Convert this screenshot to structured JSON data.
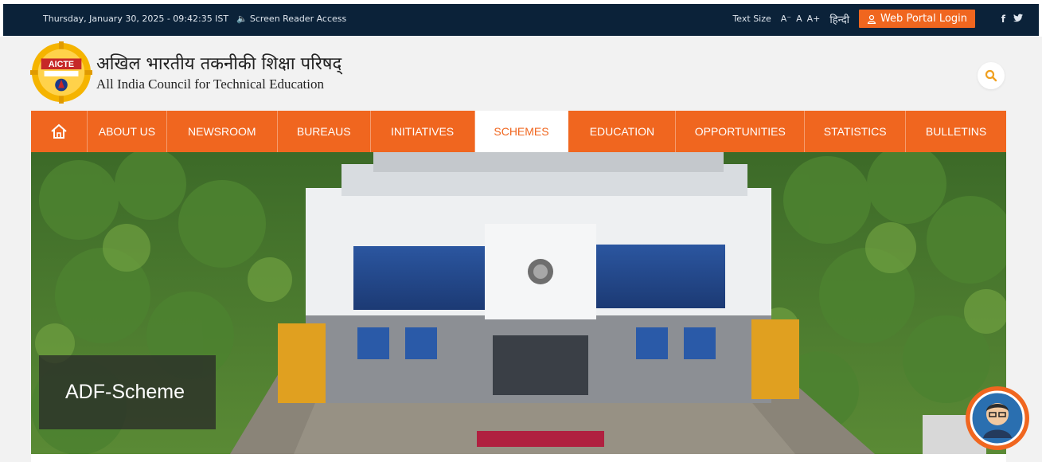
{
  "topbar": {
    "datetime": "Thursday, January 30, 2025 - 09:42:35 IST",
    "screen_reader": "Screen Reader Access",
    "text_size_label": "Text Size",
    "font_decrease": "A⁻",
    "font_normal": "A",
    "font_increase": "A+",
    "hindi": "हिन्दी",
    "portal_login": "Web Portal Login",
    "social": {
      "facebook": "f",
      "twitter": "twitter-icon"
    }
  },
  "header": {
    "logo_text": "AICTE",
    "title_hindi": "अखिल भारतीय तकनीकी शिक्षा परिषद्",
    "title_english": "All India Council for Technical Education"
  },
  "nav": {
    "items": [
      {
        "label": "ABOUT US"
      },
      {
        "label": "NEWSROOM"
      },
      {
        "label": "BUREAUS"
      },
      {
        "label": "INITIATIVES"
      },
      {
        "label": "SCHEMES",
        "active": true
      },
      {
        "label": "EDUCATION"
      },
      {
        "label": "OPPORTUNITIES"
      },
      {
        "label": "STATISTICS"
      },
      {
        "label": "BULLETINS"
      }
    ]
  },
  "hero": {
    "caption": "ADF-Scheme"
  },
  "colors": {
    "accent": "#f0661f",
    "topbar_bg": "#0b2239"
  },
  "icons": [
    "speaker-icon",
    "user-icon",
    "facebook-icon",
    "twitter-icon",
    "search-icon",
    "home-icon",
    "chatbot-avatar-icon"
  ]
}
